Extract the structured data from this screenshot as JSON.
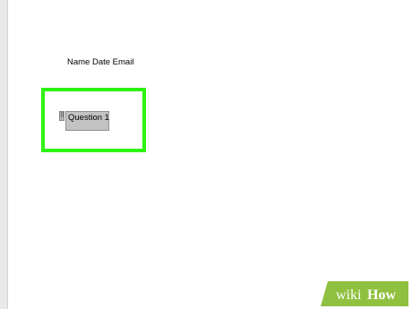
{
  "document": {
    "header_line": "Name Date Email",
    "content_control": {
      "tab_glyph": "⠿",
      "placeholder_text": "Question 1"
    }
  },
  "highlight": {
    "color": "#2df40f"
  },
  "watermark": {
    "wiki": "wiki",
    "how": "How",
    "color": "#8fc03f"
  }
}
